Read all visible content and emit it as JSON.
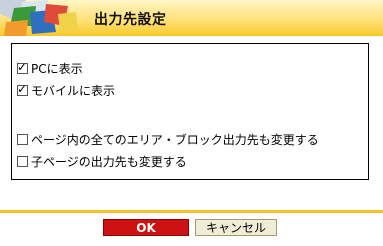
{
  "dialog": {
    "title": "出力先設定",
    "logo_icon": "colorful-blocks-logo",
    "accent_color": "#f7c928"
  },
  "options": [
    {
      "label": "PCに表示",
      "checked": true
    },
    {
      "label": "モバイルに表示",
      "checked": true
    },
    {
      "label": "ページ内の全てのエリア・ブロック出力先も変更する",
      "checked": false
    },
    {
      "label": "子ページの出力先も変更する",
      "checked": false
    }
  ],
  "buttons": {
    "ok_label": "OK",
    "cancel_label": "キャンセル",
    "ok_color": "#cc1212"
  }
}
